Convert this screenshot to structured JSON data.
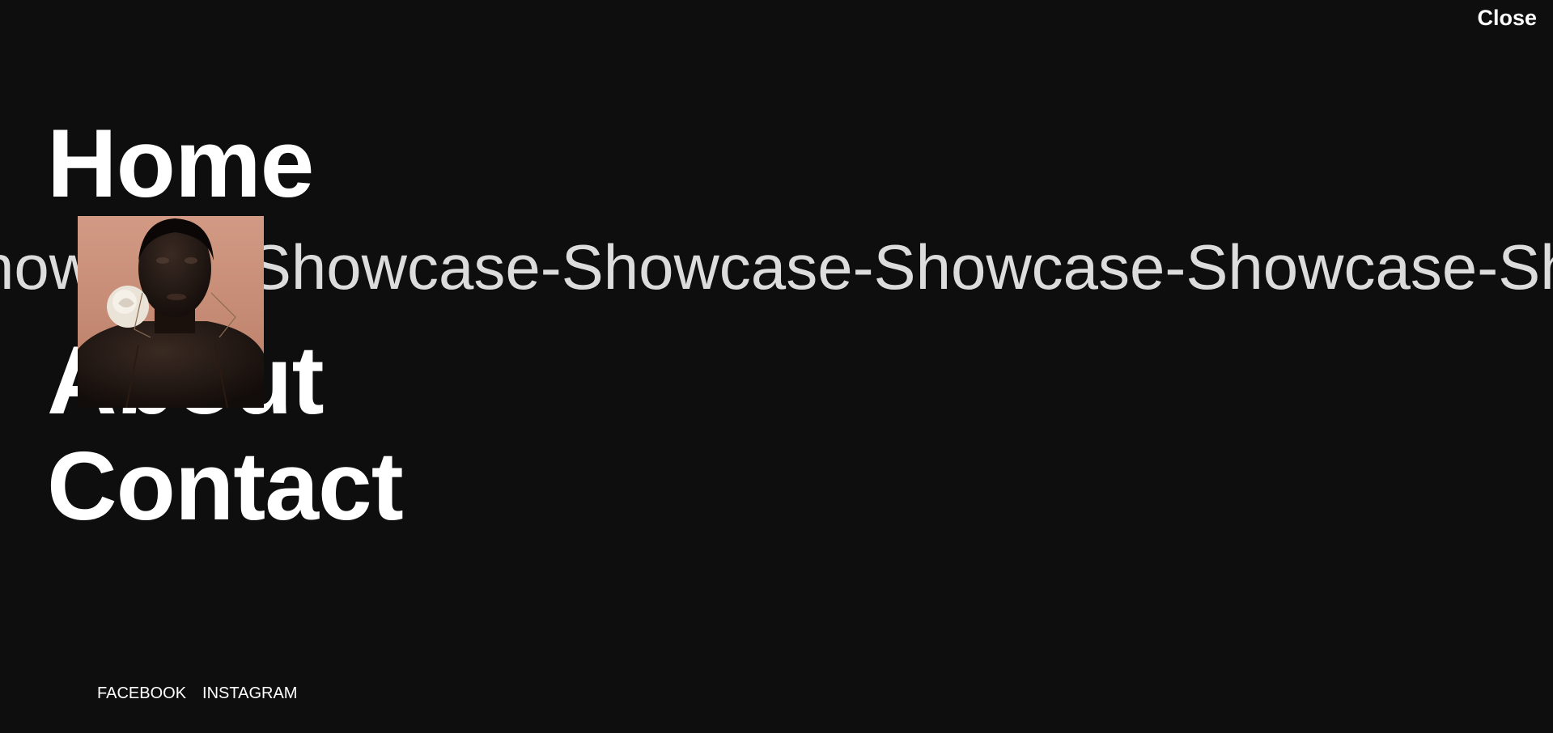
{
  "header": {
    "close_label": "Close"
  },
  "nav": {
    "items": [
      {
        "label": "Home"
      },
      {
        "label": "About"
      },
      {
        "label": "Contact"
      }
    ]
  },
  "marquee": {
    "text": "Showcase-Showcase-Showcase-Showcase-Showcase-Showcase-Sh"
  },
  "photo": {
    "subject": "portrait-photo"
  },
  "social": {
    "facebook_label": "FACEBOOK",
    "instagram_label": "INSTAGRAM"
  },
  "colors": {
    "background": "#0e0e0e",
    "text": "#ffffff",
    "marquee_text": "#dcdcdc",
    "photo_backdrop": "#c98f78"
  }
}
